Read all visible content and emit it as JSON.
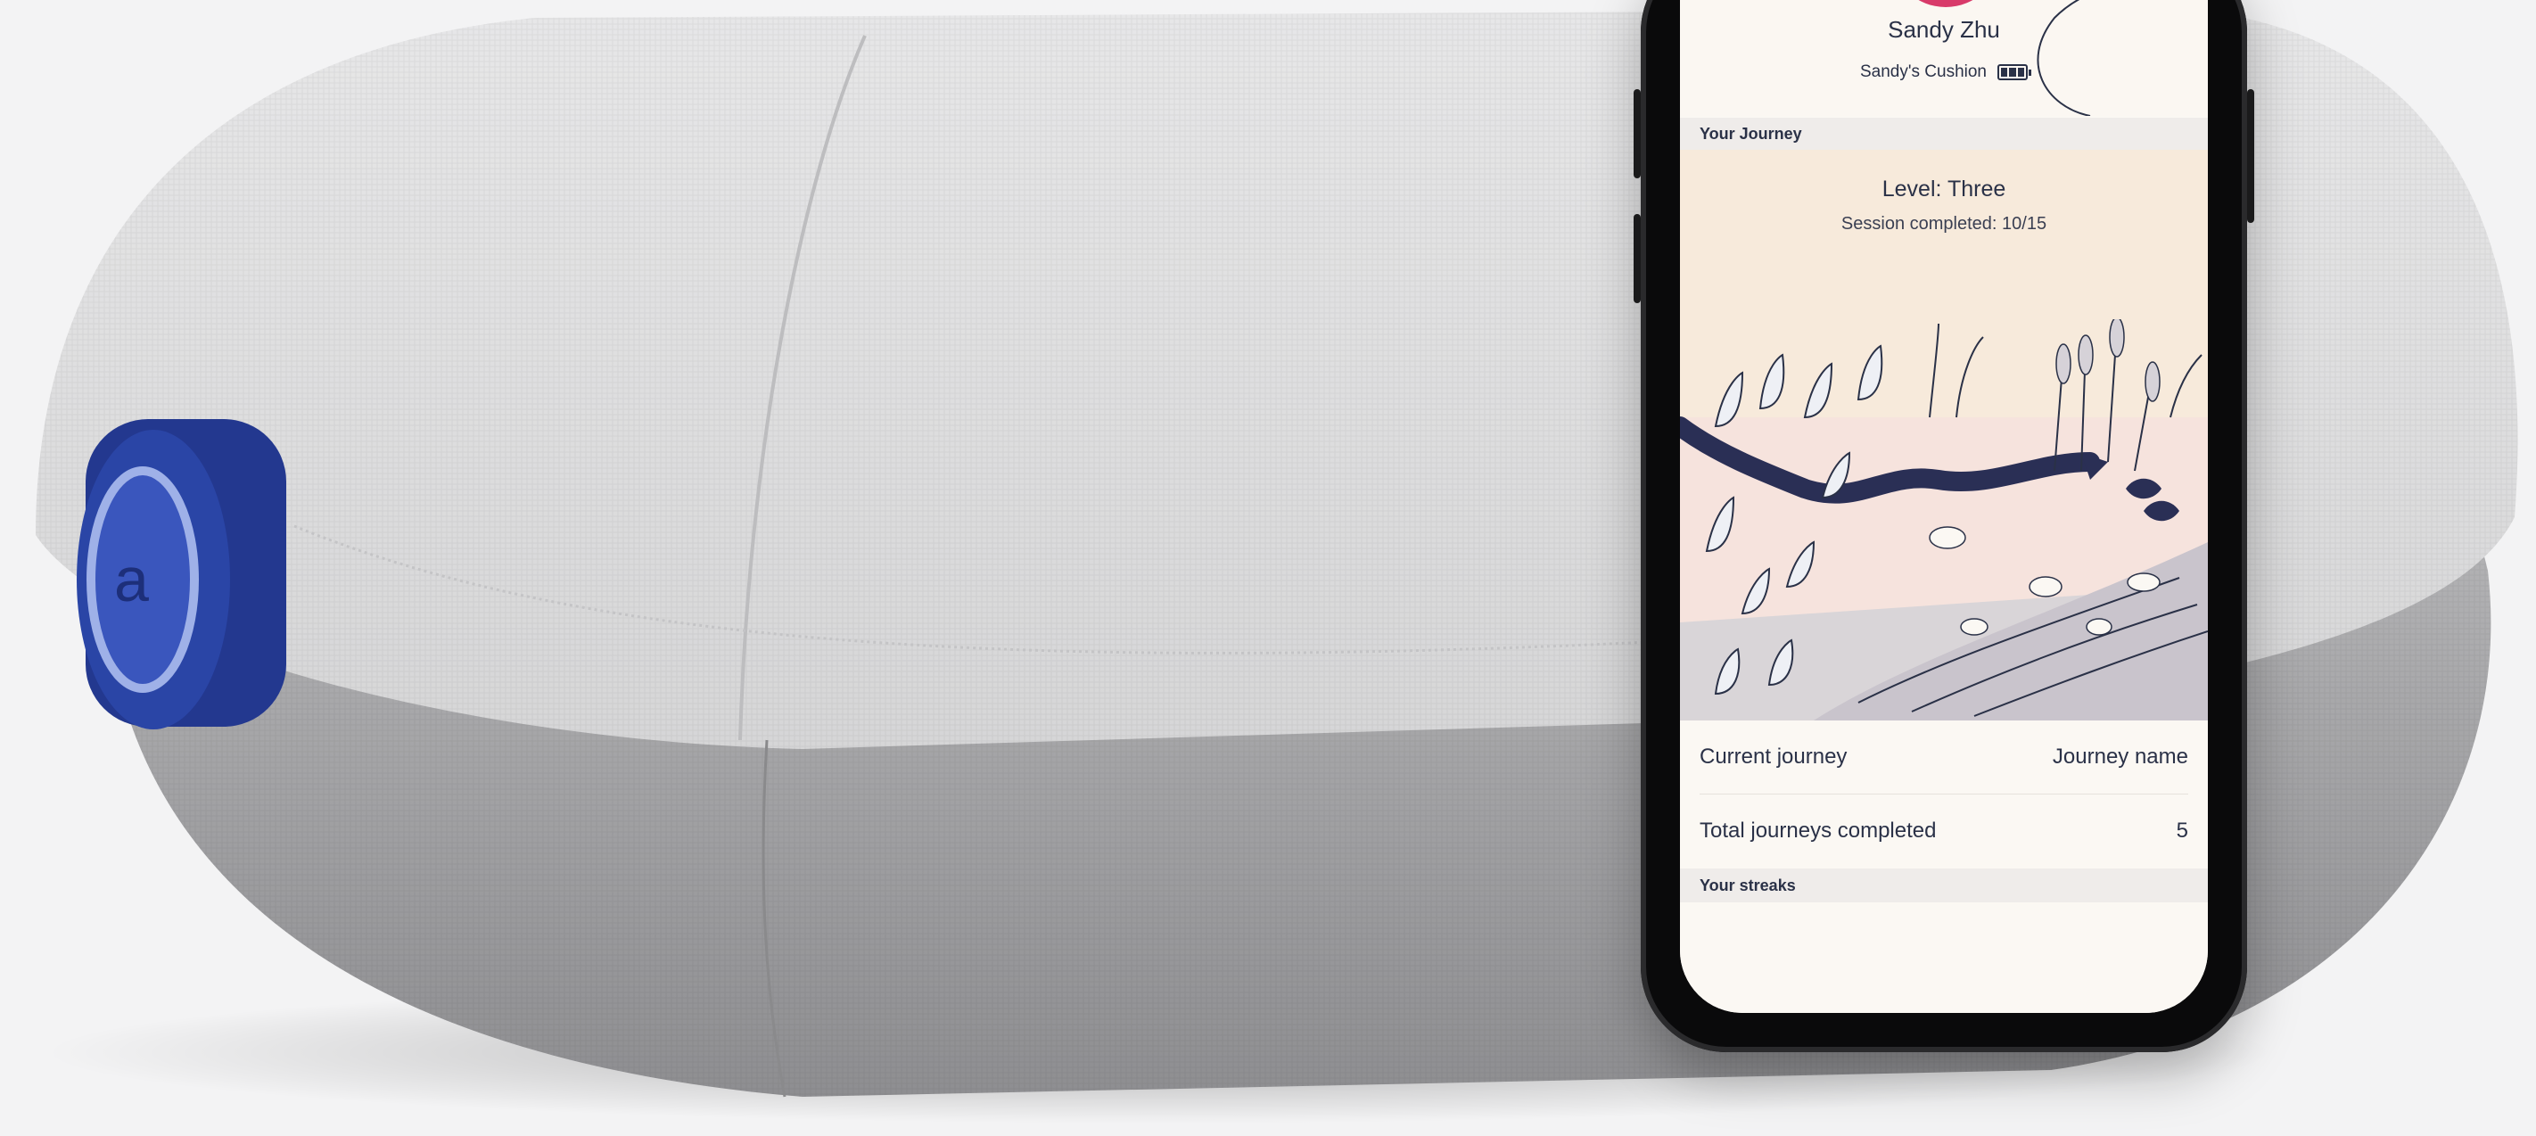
{
  "profile": {
    "user_name": "Sandy Zhu",
    "device_name": "Sandy's Cushion",
    "battery_icon": "battery-icon"
  },
  "journey_section": {
    "header": "Your Journey",
    "level": "Level: Three",
    "session_status": "Session completed: 10/15"
  },
  "stats": {
    "current_journey_label": "Current journey",
    "current_journey_value": "Journey name",
    "total_label": "Total journeys completed",
    "total_value": "5"
  },
  "streaks_section": {
    "header": "Your streaks"
  },
  "device_logo": "a",
  "colors": {
    "accent_blue": "#2a45a6",
    "text_dark": "#2a3147",
    "journey_bg": "#f7eadb",
    "section_bar": "#efecea"
  }
}
